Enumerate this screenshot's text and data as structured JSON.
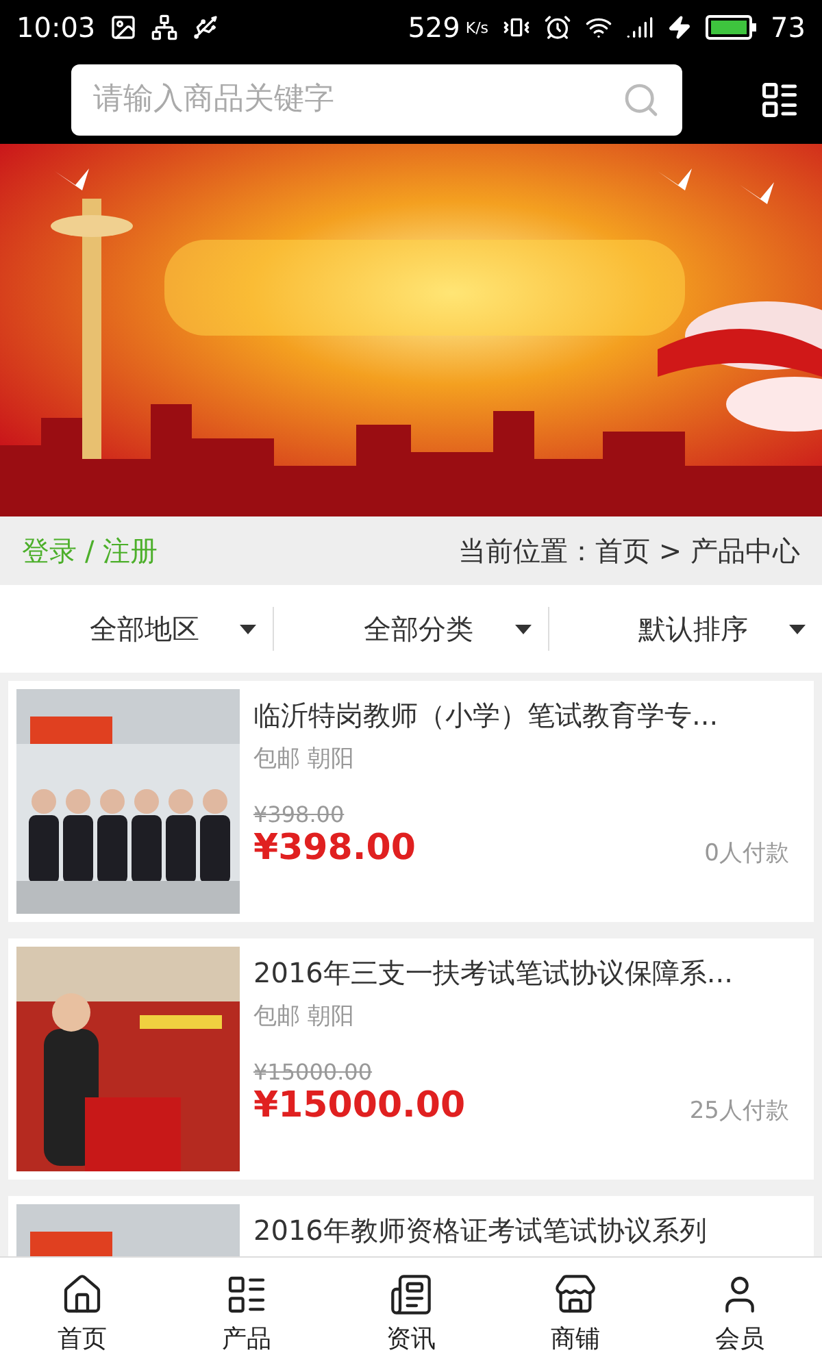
{
  "status_bar": {
    "time": "10:03",
    "speed": "529",
    "speed_unit": "K/s",
    "battery": "73"
  },
  "search": {
    "placeholder": "请输入商品关键字"
  },
  "breadcrumb": {
    "login": "登录",
    "separator": "/",
    "register": "注册",
    "location": "当前位置：首页 > 产品中心"
  },
  "filters": [
    {
      "label": "全部地区"
    },
    {
      "label": "全部分类"
    },
    {
      "label": "默认排序"
    }
  ],
  "products": [
    {
      "kind": "picture",
      "title": "临沂特岗教师（小学）笔试教育学专...",
      "tags": "包邮 朝阳",
      "old_price": "¥398.00",
      "price": "¥398.00",
      "paid": "0人付款"
    },
    {
      "kind": "picture",
      "title": "2016年三支一扶考试笔试协议保障系...",
      "tags": "包邮 朝阳",
      "old_price": "¥15000.00",
      "price": "¥15000.00",
      "paid": "25人付款"
    },
    {
      "kind": "picture",
      "title": "2016年教师资格证考试笔试协议系列"
    }
  ],
  "tab_bar": [
    {
      "kind": "home",
      "label": "首页"
    },
    {
      "kind": "list",
      "label": "产品"
    },
    {
      "kind": "news",
      "label": "资讯"
    },
    {
      "kind": "shop",
      "label": "商铺"
    },
    {
      "kind": "user",
      "label": "会员"
    }
  ]
}
